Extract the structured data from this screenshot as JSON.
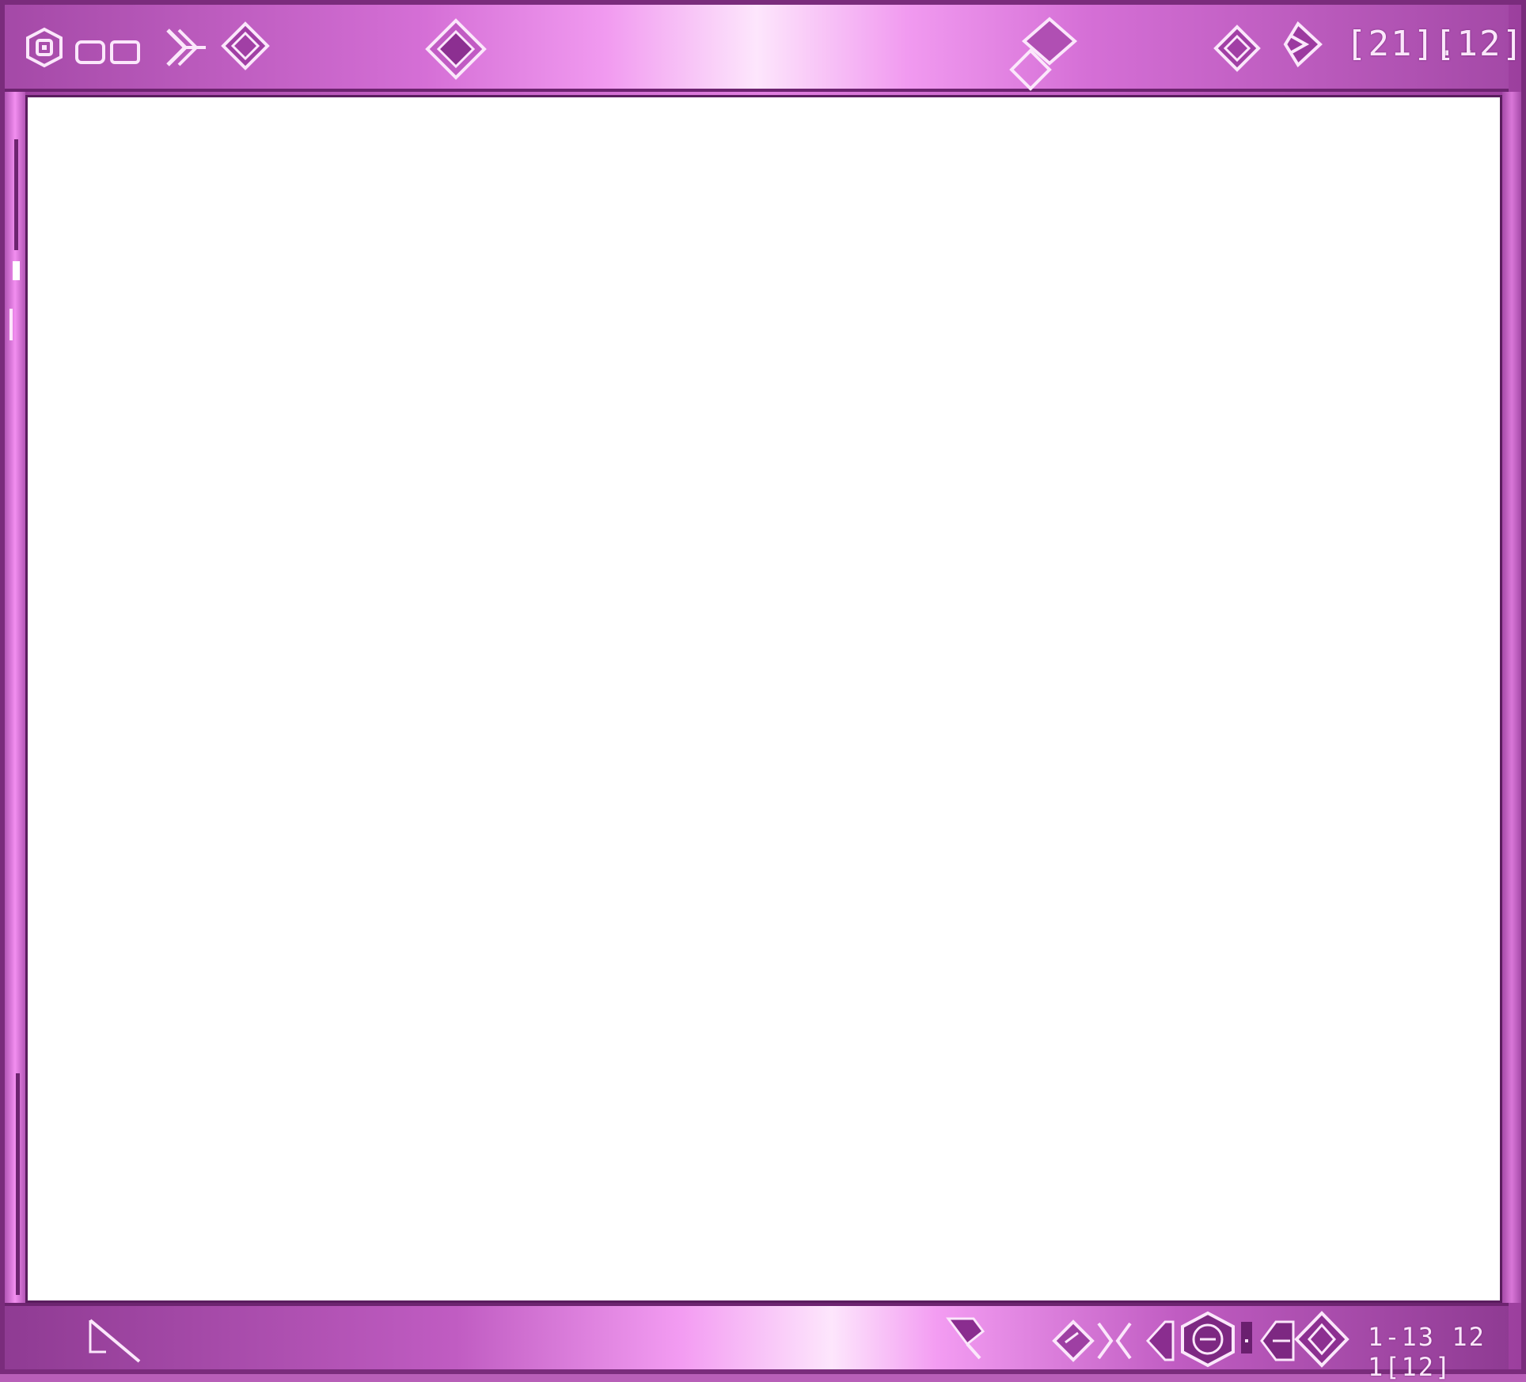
{
  "window": {
    "theme_colors": {
      "frame": "#b85fb8",
      "frame_dark": "#7a2c7c",
      "highlight": "#fde6fc",
      "content_bg": "#ffffff",
      "icon_stroke": "#fbe7fb"
    }
  },
  "titlebar": {
    "icons": [
      "settings-icon",
      "window-icon",
      "window-icon",
      "chevron-right-icon",
      "diamond-icon",
      "diamond-icon",
      "diamond-pair-icon",
      "diamond-icon",
      "diamond-arrow-icon"
    ],
    "readout_left": "[21]..",
    "readout_right": "[12]"
  },
  "statusbar": {
    "icons": [
      "slash-tool-icon",
      "pin-icon",
      "diamond-icon",
      "chevron-icon",
      "back-icon",
      "hexagon-icon",
      "bar-icon",
      "back-arrow-icon",
      "diamond-icon"
    ],
    "readout": "1-13 12 1[12]"
  }
}
